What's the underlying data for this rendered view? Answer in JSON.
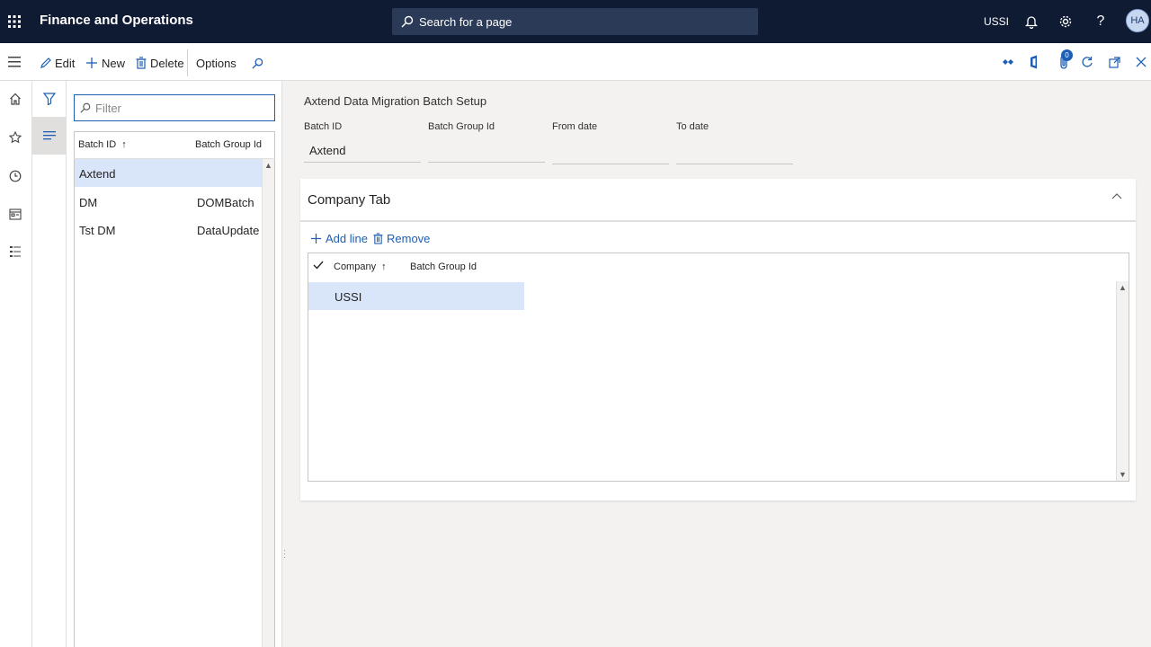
{
  "header": {
    "app_title": "Finance and Operations",
    "search_placeholder": "Search for a page",
    "company": "USSI",
    "avatar_initials": "HA"
  },
  "actions": {
    "edit": "Edit",
    "new": "New",
    "delete": "Delete",
    "options": "Options",
    "attachments_count": "0"
  },
  "list": {
    "filter_placeholder": "Filter",
    "columns": [
      "Batch ID",
      "Batch Group Id"
    ],
    "sort_indicator": "↑",
    "rows": [
      {
        "batch_id": "Axtend",
        "batch_group_id": ""
      },
      {
        "batch_id": "DM",
        "batch_group_id": "DOMBatch"
      },
      {
        "batch_id": "Tst DM",
        "batch_group_id": "DataUpdate"
      }
    ]
  },
  "details": {
    "title": "Axtend Data Migration Batch Setup",
    "fields": [
      {
        "label": "Batch ID",
        "value": "Axtend"
      },
      {
        "label": "Batch Group Id",
        "value": ""
      },
      {
        "label": "From date",
        "value": ""
      },
      {
        "label": "To date",
        "value": ""
      }
    ],
    "company_tab": {
      "title": "Company Tab",
      "add_line": "Add line",
      "remove": "Remove",
      "columns": [
        "Company",
        "Batch Group Id"
      ],
      "sort_indicator": "↑",
      "rows": [
        {
          "company": "USSI",
          "batch_group_id": ""
        }
      ]
    }
  },
  "colors": {
    "header_bg": "#0f1b33",
    "accent": "#1d5fb5",
    "selected_row": "#d9e5f9"
  }
}
